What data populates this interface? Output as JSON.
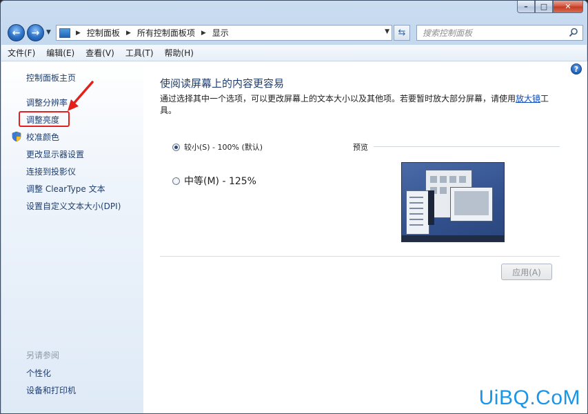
{
  "breadcrumbs": [
    "控制面板",
    "所有控制面板项",
    "显示"
  ],
  "search": {
    "placeholder": "搜索控制面板"
  },
  "menu": [
    "文件(F)",
    "编辑(E)",
    "查看(V)",
    "工具(T)",
    "帮助(H)"
  ],
  "sidebar": {
    "home": "控制面板主页",
    "items": [
      "调整分辨率",
      "调整亮度",
      "校准颜色",
      "更改显示器设置",
      "连接到投影仪",
      "调整 ClearType 文本",
      "设置自定义文本大小(DPI)"
    ],
    "see_also_label": "另请参阅",
    "see_also": [
      "个性化",
      "设备和打印机"
    ]
  },
  "main": {
    "heading": "使阅读屏幕上的内容更容易",
    "desc_before": "通过选择其中一个选项，可以更改屏幕上的文本大小以及其他项。若要暂时放大部分屏幕，请使用",
    "desc_link": "放大镜",
    "desc_after": "工具。",
    "options": [
      {
        "label": "较小(S) - 100% (默认)",
        "checked": true
      },
      {
        "label": "中等(M) - 125%",
        "checked": false
      }
    ],
    "preview_label": "预览",
    "apply": "应用(A)"
  },
  "watermark": "UiBQ.CoM",
  "colors": {
    "highlight": "#e3201b",
    "link": "#0b4cbf",
    "heading": "#1e3d6e"
  }
}
